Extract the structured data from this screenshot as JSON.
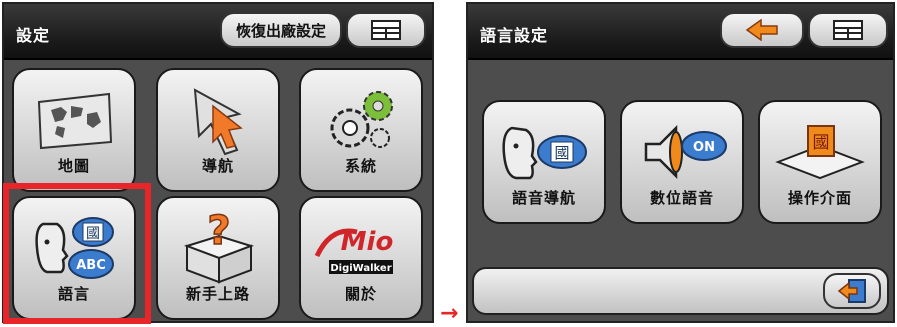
{
  "left_screen": {
    "title": "設定",
    "restore_button_label": "恢復出廠設定",
    "menu_icon": "grid-menu-icon",
    "tiles": [
      {
        "label": "地圖",
        "icon": "map-icon"
      },
      {
        "label": "導航",
        "icon": "navigation-arrow-icon"
      },
      {
        "label": "系統",
        "icon": "gears-icon"
      },
      {
        "label": "語言",
        "icon": "language-bubbles-icon"
      },
      {
        "label": "新手上路",
        "icon": "question-box-icon"
      },
      {
        "label": "關於",
        "icon": "mio-logo-icon"
      }
    ],
    "selected_tile": "語言",
    "highlight_color": "#e8262a"
  },
  "right_screen": {
    "title": "語言設定",
    "back_icon": "back-arrow-icon",
    "menu_icon": "grid-menu-icon",
    "tiles": [
      {
        "label": "語音導航",
        "icon": "voice-guide-icon"
      },
      {
        "label": "數位語音",
        "icon": "speaker-on-icon"
      },
      {
        "label": "操作介面",
        "icon": "interface-flag-icon"
      }
    ],
    "bottom_icon": "exit-door-icon"
  },
  "transition_arrow": "→",
  "mio_logo": {
    "brand": "Mio",
    "badge": "DigiWalker"
  },
  "speaker_badge": "ON",
  "bubble_text": {
    "kanji": "國",
    "latin": "ABC"
  }
}
